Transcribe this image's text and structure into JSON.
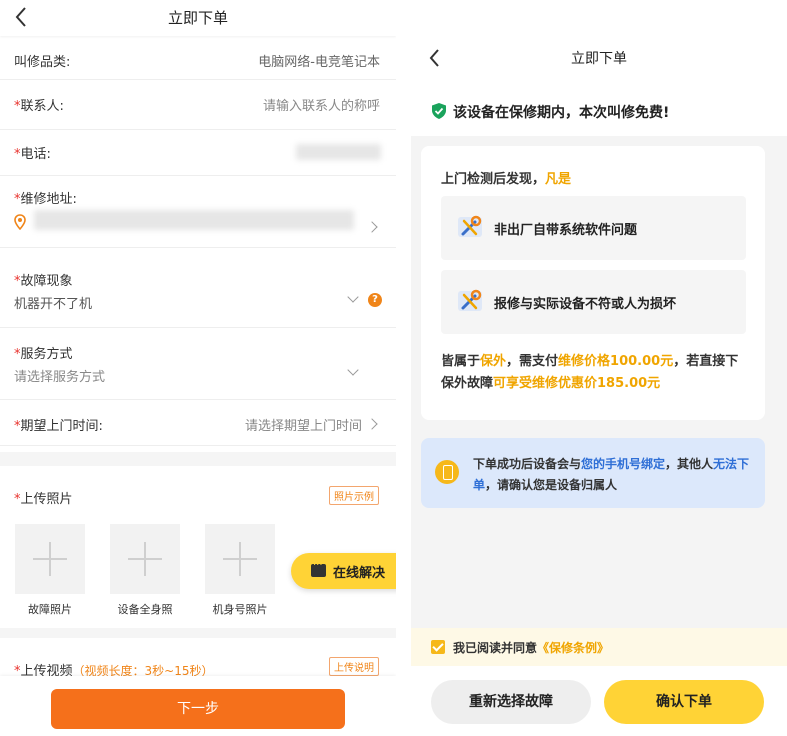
{
  "left": {
    "header": {
      "title": "立即下单"
    },
    "fields": {
      "category": {
        "label": "叫修品类:",
        "value": "电脑网络-电竞笔记本"
      },
      "contact": {
        "required": "*",
        "label": "联系人:",
        "placeholder": "请输入联系人的称呼"
      },
      "phone": {
        "required": "*",
        "label": "电话:"
      },
      "address": {
        "required": "*",
        "label": "维修地址:"
      },
      "fault": {
        "required": "*",
        "label": "故障现象",
        "value": "机器开不了机"
      },
      "service": {
        "required": "*",
        "label": "服务方式",
        "placeholder": "请选择服务方式"
      },
      "time": {
        "required": "*",
        "label": "期望上门时间:",
        "placeholder": "请选择期望上门时间"
      }
    },
    "photos": {
      "required": "*",
      "title": "上传照片",
      "example_tag": "照片示例",
      "items": [
        {
          "caption": "故障照片"
        },
        {
          "caption": "设备全身照"
        },
        {
          "caption": "机身号照片"
        }
      ]
    },
    "online_button": "在线解决",
    "video": {
      "required": "*",
      "title": "上传视频",
      "hint": "（视频长度：3秒~15秒）",
      "tag": "上传说明"
    },
    "next_button": "下一步"
  },
  "right": {
    "header": {
      "title": "立即下单"
    },
    "free_notice": "该设备在保修期内，本次叫修免费!",
    "card": {
      "title_prefix": "上门检测后发现，",
      "title_accent": "凡是",
      "cases": [
        {
          "text": "非出厂自带系统软件问题"
        },
        {
          "text": "报修与实际设备不符或人为损坏"
        }
      ],
      "note_1": "皆属于",
      "note_accent_1": "保外",
      "note_2": "，需支付",
      "note_accent_2": "维修价格100.00元",
      "note_3": "，若直接下保外故障",
      "note_accent_3": "可享受维修优惠价185.00元"
    },
    "bind_notice": {
      "text_1": "下单成功后设备会与",
      "blue_1": "您的手机号绑定",
      "text_2": "，其他人",
      "blue_2": "无法下单",
      "text_3": "，请确认您是设备归属人"
    },
    "agreement": {
      "text": "我已阅读并同意",
      "link": "《保修条例》",
      "checked": true
    },
    "reselect_button": "重新选择故障",
    "confirm_button": "确认下单"
  },
  "colors": {
    "orange_primary": "#f5701b",
    "yellow_primary": "#ffd336",
    "accent": "#f0a500",
    "link_blue": "#2f6fd6"
  }
}
